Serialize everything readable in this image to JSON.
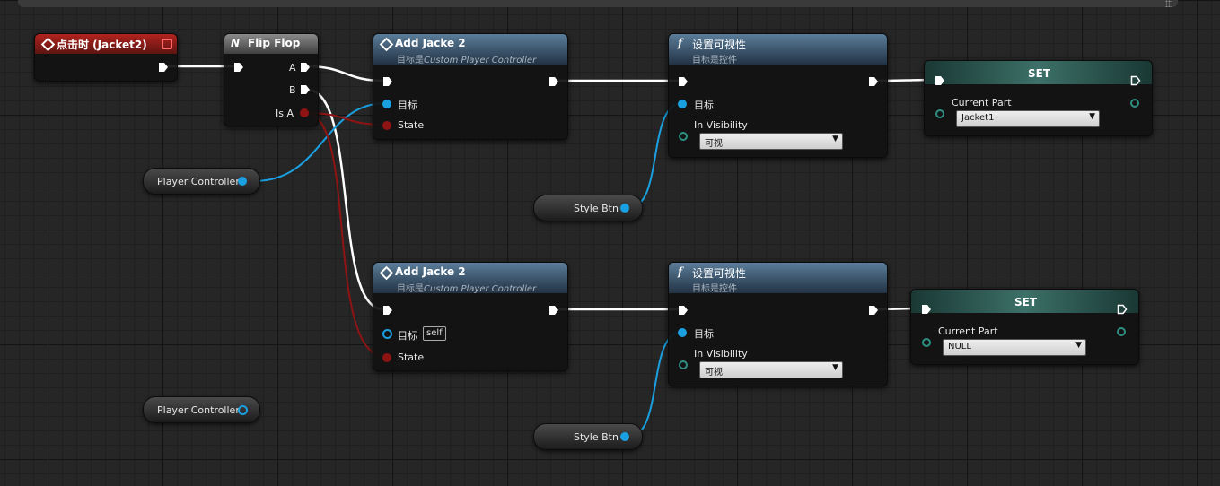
{
  "event_node": {
    "title": "点击时 (Jacket2)"
  },
  "flipflop_node": {
    "title": "Flip Flop",
    "icon": "N",
    "out_a": "A",
    "out_b": "B",
    "out_isa": "Is A"
  },
  "add_jacke_1": {
    "title": "Add Jacke 2",
    "subtitle_prefix": "目标是",
    "subtitle_target": "Custom Player Controller",
    "target_label": "目标",
    "state_label": "State"
  },
  "add_jacke_2": {
    "title": "Add Jacke 2",
    "subtitle_prefix": "目标是",
    "subtitle_target": "Custom Player Controller",
    "target_label": "目标",
    "target_default": "self",
    "state_label": "State"
  },
  "set_vis_1": {
    "title": "设置可视性",
    "icon": "f",
    "subtitle": "目标是控件",
    "target_label": "目标",
    "visibility_label": "In Visibility",
    "visibility_value": "可视"
  },
  "set_vis_2": {
    "title": "设置可视性",
    "icon": "f",
    "subtitle": "目标是控件",
    "target_label": "目标",
    "visibility_label": "In Visibility",
    "visibility_value": "可视"
  },
  "set_1": {
    "title": "SET",
    "var_label": "Current Part",
    "var_value": "Jacket1"
  },
  "set_2": {
    "title": "SET",
    "var_label": "Current Part",
    "var_value": "NULL"
  },
  "vars": {
    "player_controller_1": "Player Controller",
    "player_controller_2": "Player Controller",
    "style_btn_1": "Style Btn",
    "style_btn_2": "Style Btn"
  },
  "colors": {
    "exec": "#ffffff",
    "object_pin": "#1aa0e0",
    "bool_pin": "#8e1414",
    "enum_pin": "#2f8f83",
    "event_header": "#b3231e",
    "function_header": "#5b7d99"
  }
}
